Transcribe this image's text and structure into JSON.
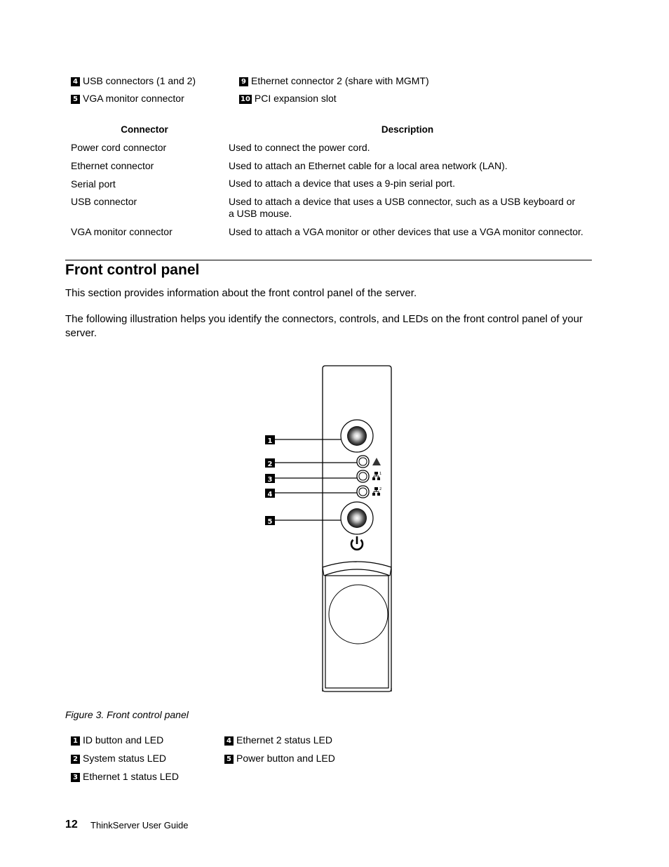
{
  "top_legend": [
    {
      "num": "4",
      "label": "USB connectors (1 and 2)"
    },
    {
      "num": "5",
      "label": "VGA monitor connector"
    },
    {
      "num": "9",
      "label": "Ethernet connector 2 (share with MGMT)"
    },
    {
      "num": "10",
      "label": "PCI expansion slot"
    }
  ],
  "connector_table": {
    "headers": {
      "connector": "Connector",
      "description": "Description"
    },
    "rows": [
      {
        "connector": "Power cord connector",
        "description": "Used to connect the power cord."
      },
      {
        "connector": "Ethernet connector",
        "description": "Used to attach an Ethernet cable for a local area network (LAN)."
      },
      {
        "connector": "Serial port",
        "description": "Used to attach a device that uses a 9-pin serial port."
      },
      {
        "connector": "USB connector",
        "description": "Used to attach a device that uses a USB connector, such as a USB keyboard or a USB mouse."
      },
      {
        "connector": "VGA monitor connector",
        "description": "Used to attach a VGA monitor or other devices that use a VGA monitor connector."
      }
    ]
  },
  "section": {
    "title": "Front control panel",
    "intro": "This section provides information about the front control panel of the server.",
    "illustration_text": "The following illustration helps you identify the connectors, controls, and LEDs on the front control panel of your server."
  },
  "figure": {
    "callouts": [
      "1",
      "2",
      "3",
      "4",
      "5"
    ],
    "caption": "Figure 3.  Front control panel"
  },
  "figure_legend": [
    {
      "num": "1",
      "label": "ID button and LED"
    },
    {
      "num": "2",
      "label": "System status LED"
    },
    {
      "num": "3",
      "label": "Ethernet 1 status LED"
    },
    {
      "num": "4",
      "label": "Ethernet 2 status LED"
    },
    {
      "num": "5",
      "label": "Power button and LED"
    }
  ],
  "footer": {
    "page_number": "12",
    "book_title": "ThinkServer User Guide"
  }
}
